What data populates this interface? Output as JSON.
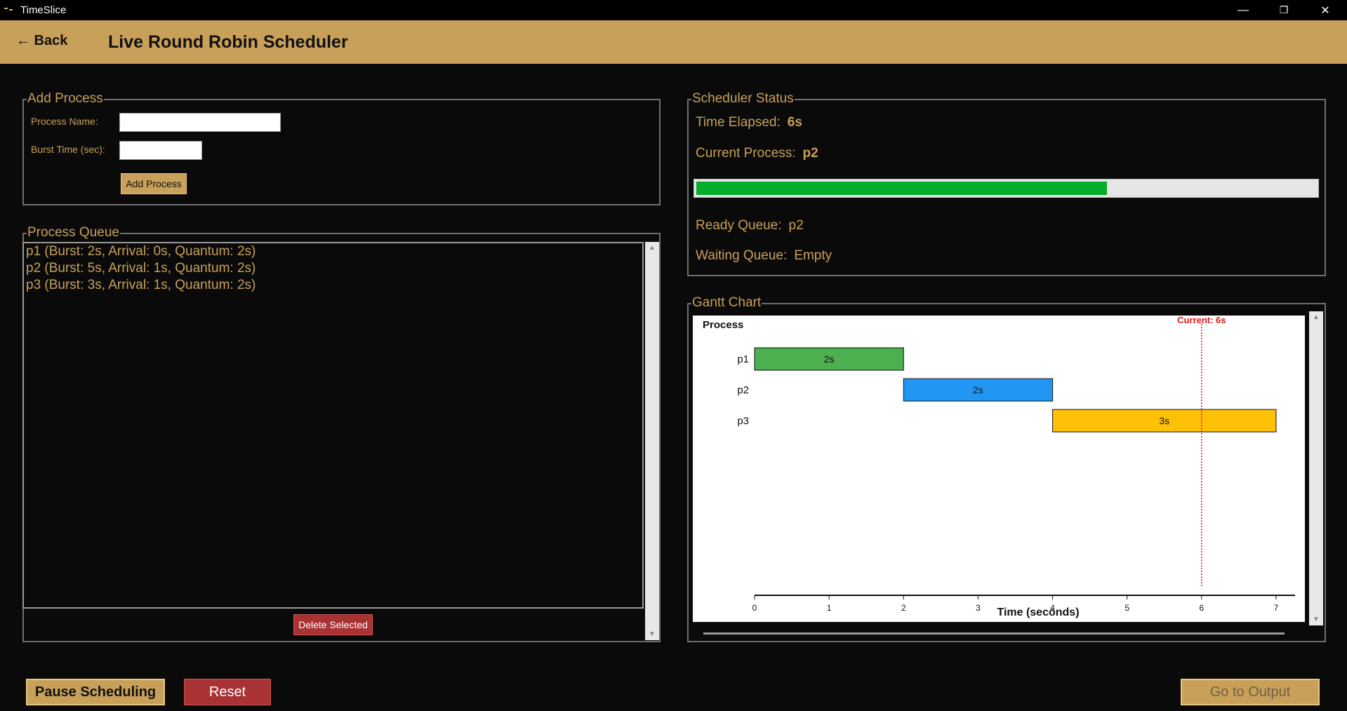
{
  "window": {
    "title": "TimeSlice",
    "minimize": "—",
    "restore": "❐",
    "close": "✕"
  },
  "header": {
    "back_label": "← Back",
    "title": "Live Round Robin Scheduler"
  },
  "add_process": {
    "group_label": "Add Process",
    "name_label": "Process Name:",
    "name_value": "",
    "burst_label": "Burst Time (sec):",
    "burst_value": "",
    "add_button": "Add Process"
  },
  "process_queue": {
    "group_label": "Process Queue",
    "items": [
      "p1 (Burst: 2s, Arrival: 0s, Quantum: 2s)",
      "p2 (Burst: 5s, Arrival: 1s, Quantum: 2s)",
      "p3 (Burst: 3s, Arrival: 1s, Quantum: 2s)"
    ],
    "delete_button": "Delete Selected"
  },
  "status": {
    "group_label": "Scheduler Status",
    "time_elapsed_label": "Time Elapsed:",
    "time_elapsed_value": "6s",
    "current_process_label": "Current Process:",
    "current_process_value": "p2",
    "progress_fraction": 0.662,
    "ready_queue_label": "Ready Queue:",
    "ready_queue_value": "p2",
    "waiting_queue_label": "Waiting Queue:",
    "waiting_queue_value": "Empty"
  },
  "gantt": {
    "group_label": "Gantt Chart"
  },
  "chart_data": {
    "type": "gantt",
    "ylabel": "Process",
    "xlabel": "Time (seconds)",
    "xlim": [
      0,
      7
    ],
    "xticks": [
      0,
      1,
      2,
      3,
      4,
      5,
      6,
      7
    ],
    "rows": [
      "p1",
      "p2",
      "p3"
    ],
    "bars": [
      {
        "process": "p1",
        "start": 0,
        "end": 2,
        "label": "2s",
        "color": "#4caf50"
      },
      {
        "process": "p2",
        "start": 2,
        "end": 4,
        "label": "2s",
        "color": "#2196f3"
      },
      {
        "process": "p3",
        "start": 4,
        "end": 7,
        "label": "3s",
        "color": "#ffc107"
      }
    ],
    "current_time": 6,
    "current_label": "Current: 6s",
    "current_color": "#e0151b"
  },
  "footer": {
    "pause_button": "Pause Scheduling",
    "reset_button": "Reset",
    "output_button": "Go to Output"
  },
  "colors": {
    "accent": "#c9a059",
    "background": "#0a0a0a",
    "danger": "#a83234",
    "progress": "#06ad2a"
  }
}
